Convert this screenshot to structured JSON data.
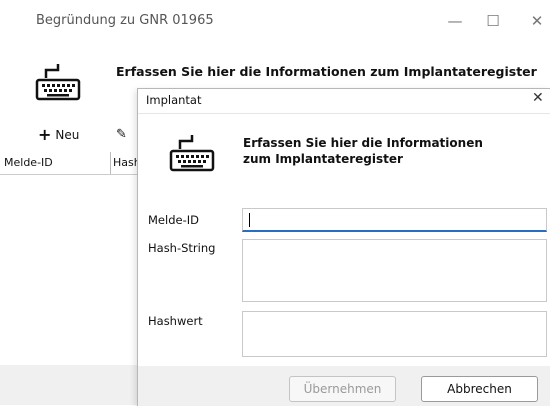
{
  "main_window": {
    "title": "Begründung zu GNR  01965",
    "heading": "Erfassen Sie hier die Informationen zum Implantateregister",
    "toolbar": {
      "new_label": "Neu"
    },
    "grid": {
      "columns": [
        "Melde-ID",
        "Hash"
      ]
    }
  },
  "dialog": {
    "title": "Implantat",
    "heading": "Erfassen Sie hier die Informationen zum Implantateregister",
    "fields": {
      "melde_id": {
        "label": "Melde-ID",
        "value": ""
      },
      "hash_string": {
        "label": "Hash-String",
        "value": ""
      },
      "hashwert": {
        "label": "Hashwert",
        "value": ""
      }
    },
    "buttons": {
      "ok": "Übernehmen",
      "cancel": "Abbrechen"
    }
  },
  "icons": [
    "keyboard-icon",
    "plus-icon",
    "edit-icon",
    "minimize-icon",
    "maximize-icon",
    "close-icon"
  ]
}
